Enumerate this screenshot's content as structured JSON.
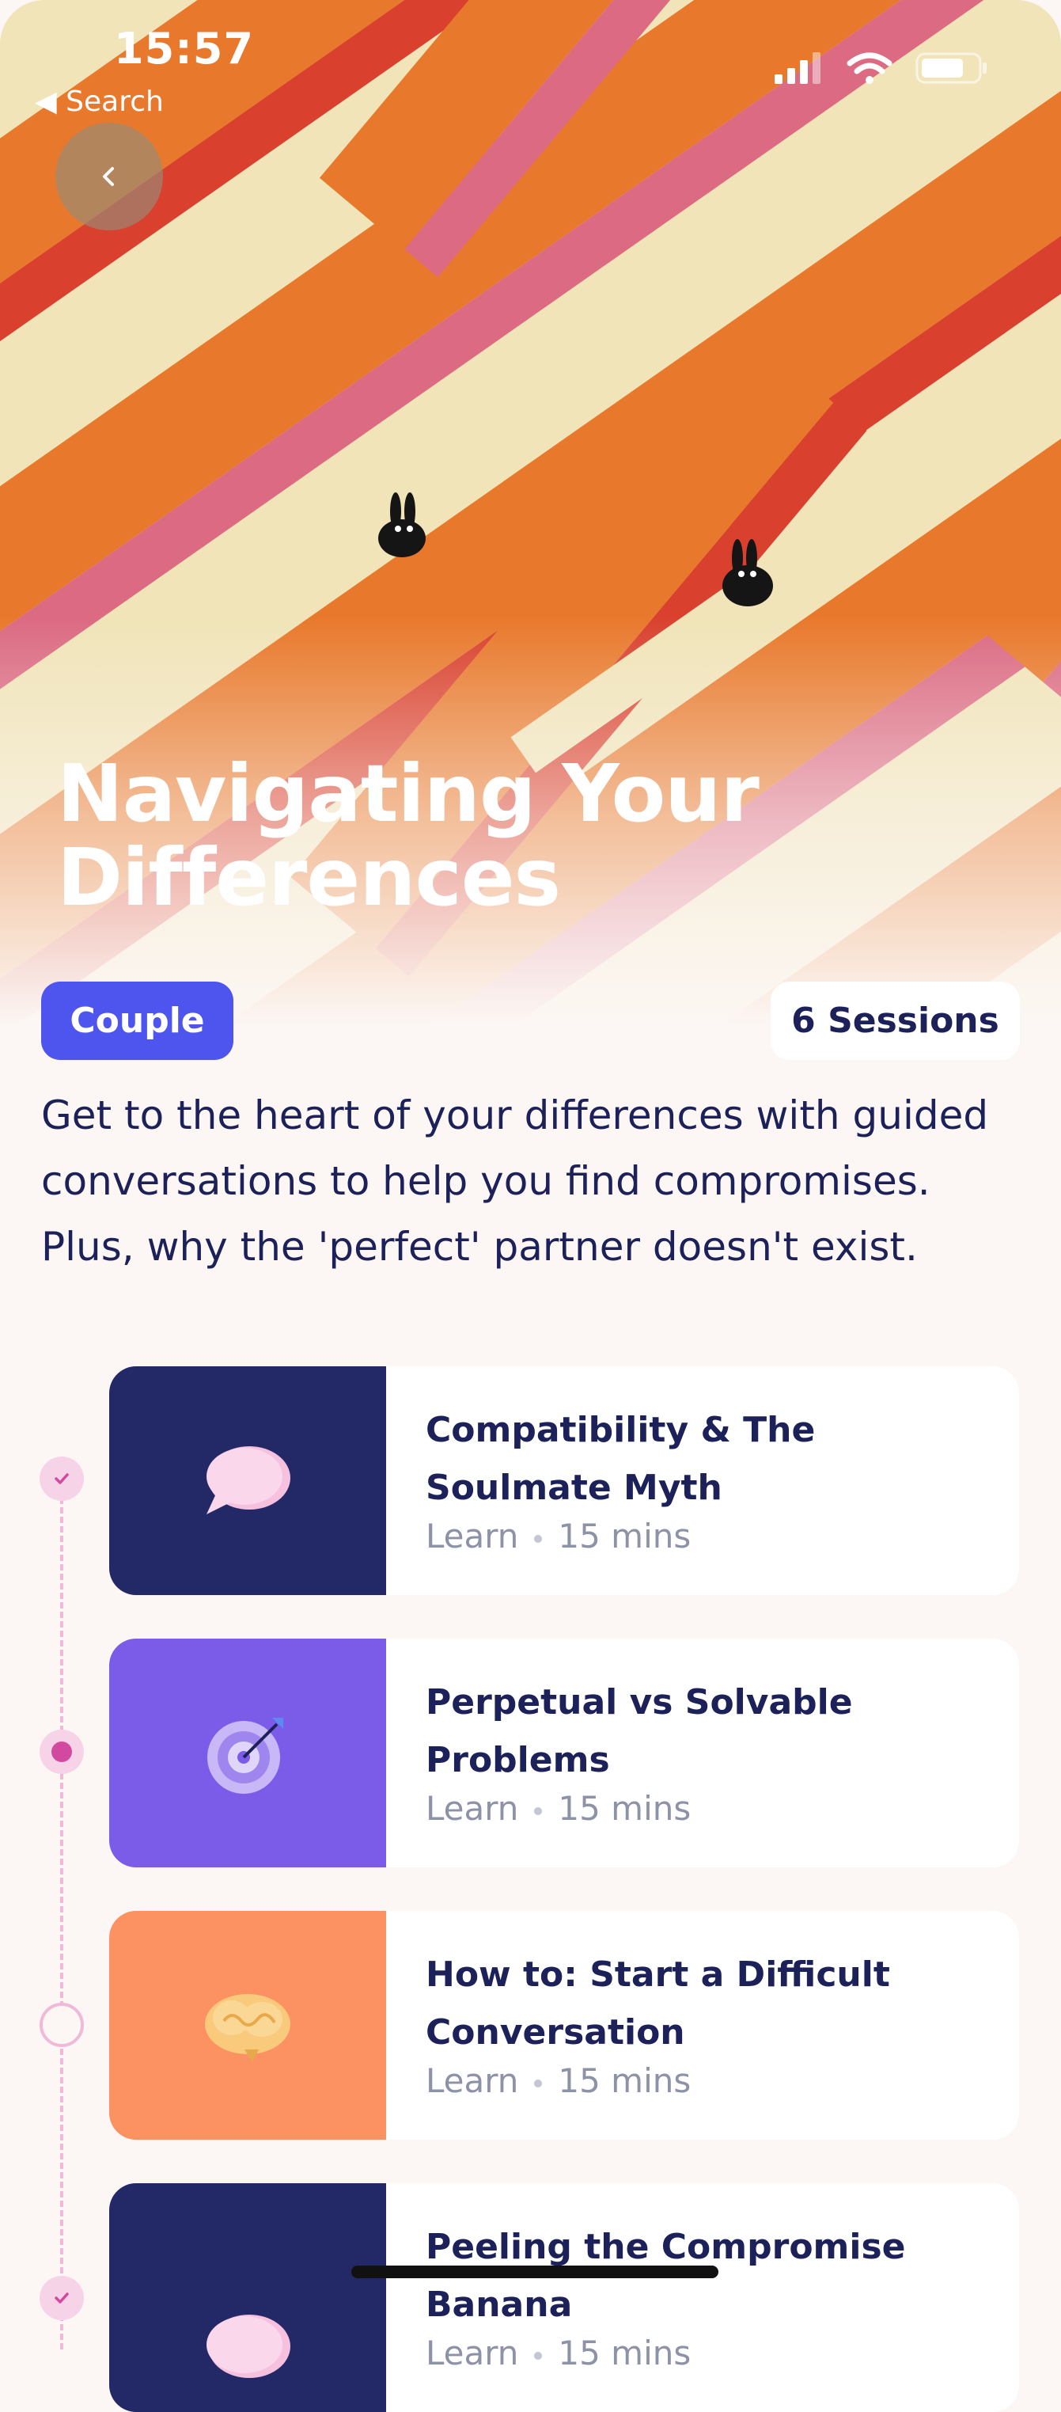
{
  "status_bar": {
    "time": "15:57",
    "back_app": "◀ Search"
  },
  "hero": {
    "title": "Navigating Your Differences",
    "colors": {
      "orange": "#e8792c",
      "red": "#d9412e",
      "pink": "#db6a82",
      "cream": "#f0e4b8"
    }
  },
  "tags": {
    "category": "Couple",
    "sessions": "6 Sessions"
  },
  "description": "Get to the heart of your differences with guided conversations to help you find compromises. Plus, why the 'perfect' partner doesn't exist.",
  "sessions": [
    {
      "title": "Compatibility & The Soulmate Myth",
      "type": "Learn",
      "duration": "15 mins",
      "icon": "speech-bubble-icon",
      "thumb_color": "#222966",
      "status": "done"
    },
    {
      "title": "Perpetual vs Solvable Problems",
      "type": "Learn",
      "duration": "15 mins",
      "icon": "target-icon",
      "thumb_color": "#7b5ce8",
      "status": "current"
    },
    {
      "title": "How to: Start a Difficult Conversation",
      "type": "Learn",
      "duration": "15 mins",
      "icon": "brain-icon",
      "thumb_color": "#fc9162",
      "status": "todo"
    },
    {
      "title": "Peeling the Compromise Banana",
      "type": "Learn",
      "duration": "15 mins",
      "icon": "speech-bubble-icon",
      "thumb_color": "#222966",
      "status": "done"
    }
  ]
}
